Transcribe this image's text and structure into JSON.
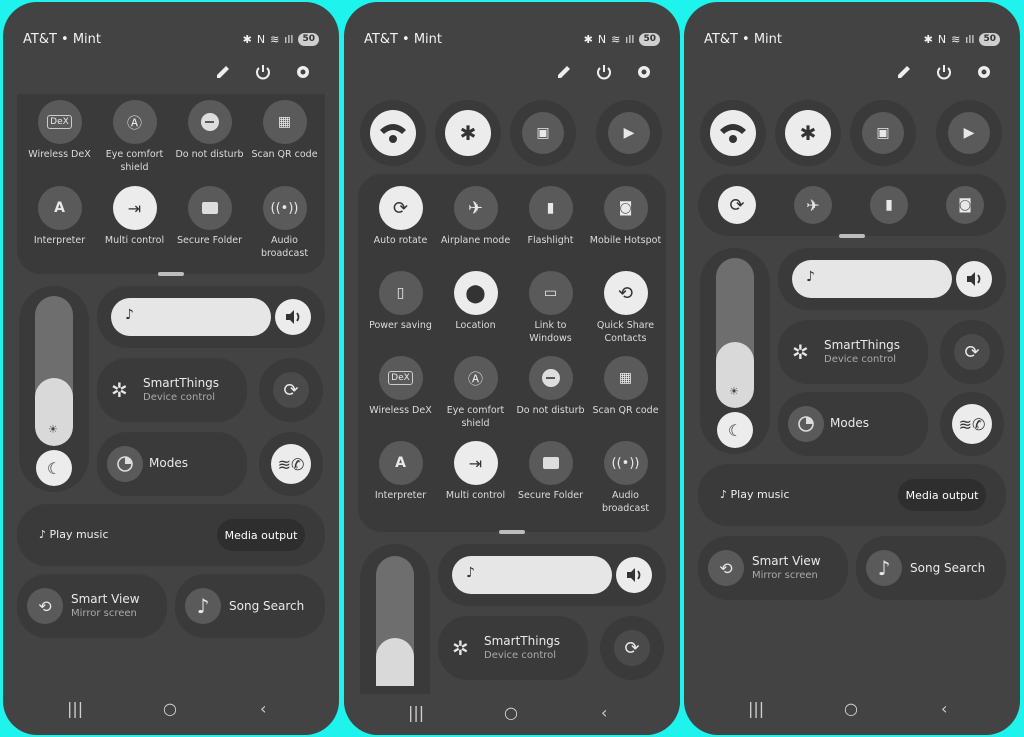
{
  "status": {
    "carrier": "AT&T • Mint",
    "battery": "50"
  },
  "tiles": {
    "wireless_dex": "Wireless DeX",
    "eye_comfort": "Eye comfort shield",
    "dnd": "Do not disturb",
    "scan_qr": "Scan QR code",
    "interpreter": "Interpreter",
    "multi_control": "Multi control",
    "secure_folder": "Secure Folder",
    "audio_broadcast": "Audio broadcast",
    "auto_rotate": "Auto rotate",
    "airplane": "Airplane mode",
    "flashlight": "Flashlight",
    "hotspot": "Mobile Hotspot",
    "power_saving": "Power saving",
    "location": "Location",
    "link_windows": "Link to Windows",
    "quick_share": "Quick Share Contacts"
  },
  "cards": {
    "smartthings_title": "SmartThings",
    "smartthings_sub": "Device control",
    "modes": "Modes",
    "play_music": "Play music",
    "media_output": "Media output",
    "smart_view_title": "Smart View",
    "smart_view_sub": "Mirror screen",
    "song_search": "Song Search"
  },
  "icons": {
    "dex_badge": "DeX",
    "music_note": "♪"
  },
  "colors": {
    "background": "#1ff3ee",
    "phone": "#434343",
    "panel": "#3a3a3a",
    "tile_on": "#ececec"
  }
}
